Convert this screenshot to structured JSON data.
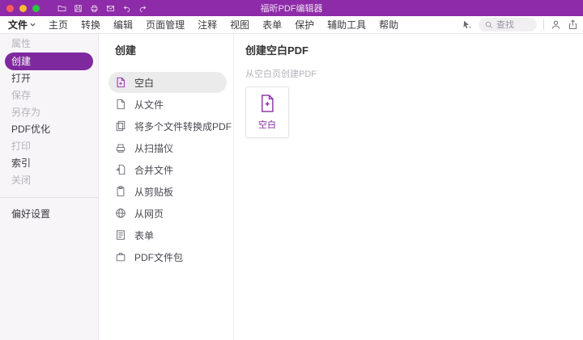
{
  "colors": {
    "titlebar_bg": "#8e2ba8",
    "accent_purple": "#7e2a9e",
    "selected_row_bg": "#ebebeb"
  },
  "titlebar": {
    "title": "福昕PDF编辑器"
  },
  "menubar": {
    "file_label": "文件",
    "items": [
      "主页",
      "转换",
      "编辑",
      "页面管理",
      "注释",
      "视图",
      "表单",
      "保护",
      "辅助工具",
      "帮助"
    ],
    "search_placeholder": "查找"
  },
  "sidebar": {
    "items": [
      {
        "label": "属性",
        "state": "disabled"
      },
      {
        "label": "创建",
        "state": "selected"
      },
      {
        "label": "打开",
        "state": "enabled"
      },
      {
        "label": "保存",
        "state": "disabled"
      },
      {
        "label": "另存为",
        "state": "disabled"
      },
      {
        "label": "PDF优化",
        "state": "enabled"
      },
      {
        "label": "打印",
        "state": "disabled"
      },
      {
        "label": "索引",
        "state": "enabled"
      },
      {
        "label": "关闭",
        "state": "disabled"
      }
    ],
    "footer_item": {
      "label": "偏好设置"
    }
  },
  "create_panel": {
    "title": "创建",
    "items": [
      {
        "label": "空白",
        "selected": true,
        "icon": "blank-doc-icon"
      },
      {
        "label": "从文件",
        "icon": "from-file-icon"
      },
      {
        "label": "将多个文件转换成PDF",
        "icon": "multi-file-icon"
      },
      {
        "label": "从扫描仪",
        "icon": "scanner-icon"
      },
      {
        "label": "合并文件",
        "icon": "combine-files-icon"
      },
      {
        "label": "从剪贴板",
        "icon": "clipboard-icon"
      },
      {
        "label": "从网页",
        "icon": "web-page-icon"
      },
      {
        "label": "表单",
        "icon": "form-icon"
      },
      {
        "label": "PDF文件包",
        "icon": "portfolio-icon"
      }
    ]
  },
  "detail_panel": {
    "title": "创建空白PDF",
    "subtitle": "从空白页创建PDF",
    "card": {
      "label": "空白"
    }
  }
}
